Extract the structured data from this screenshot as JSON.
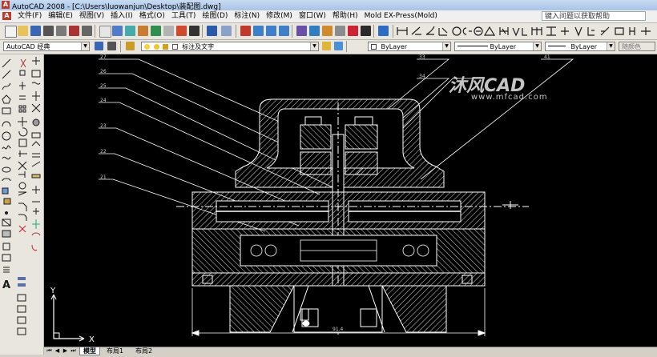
{
  "window": {
    "title": "AutoCAD 2008 - [C:\\Users\\luowanjun\\Desktop\\装配图.dwg]",
    "app_icon_letter": "A"
  },
  "menubar": {
    "items": [
      "文件(F)",
      "编辑(E)",
      "视图(V)",
      "插入(I)",
      "格式(O)",
      "工具(T)",
      "绘图(D)",
      "标注(N)",
      "修改(M)",
      "窗口(W)",
      "帮助(H)",
      "Mold EX-Press(Mold)"
    ],
    "help_search": "键入问题以获取帮助"
  },
  "toolbar2": {
    "workspace": "AutoCAD 经典",
    "layer": "标注及文字",
    "color": "ByLayer",
    "linetype": "ByLayer",
    "lineweight": "ByLayer",
    "plotstyle": "随颜色"
  },
  "drawing": {
    "part_labels": [
      "27",
      "26",
      "25",
      "24",
      "23",
      "22",
      "21",
      "33",
      "34",
      "41"
    ],
    "dimension_text": "91.4",
    "ucs_y": "Y",
    "ucs_x": "X"
  },
  "watermark": {
    "logo": "沐风CAD",
    "url": "www.mfcad.com"
  },
  "layout_tabs": [
    "模型",
    "布局1",
    "布局2"
  ],
  "colors": {
    "canvas": "#000000",
    "drawing_lines": "#ffffff",
    "titlebar": "#b9d1ee"
  }
}
